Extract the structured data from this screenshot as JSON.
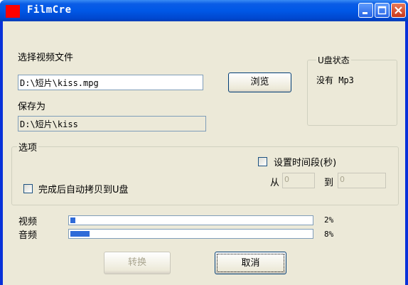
{
  "window": {
    "title": "FilmCre"
  },
  "source": {
    "label": "选择视频文件",
    "value": "D:\\短片\\kiss.mpg",
    "browse_label": "浏览"
  },
  "save": {
    "label": "保存为",
    "value": "D:\\短片\\kiss"
  },
  "udisk": {
    "legend": "U盘状态",
    "status": "没有 Mp3"
  },
  "options": {
    "legend": "选项",
    "auto_copy_label": "完成后自动拷贝到U盘",
    "time_range_label": "设置时间段(秒)",
    "from_label": "从",
    "from_value": "0",
    "to_label": "到",
    "to_value": "0"
  },
  "progress": {
    "video": {
      "label": "视频",
      "percent": 2,
      "text": "2%"
    },
    "audio": {
      "label": "音频",
      "percent": 8,
      "text": "8%"
    }
  },
  "buttons": {
    "convert_label": "转换",
    "cancel_label": "取消"
  }
}
